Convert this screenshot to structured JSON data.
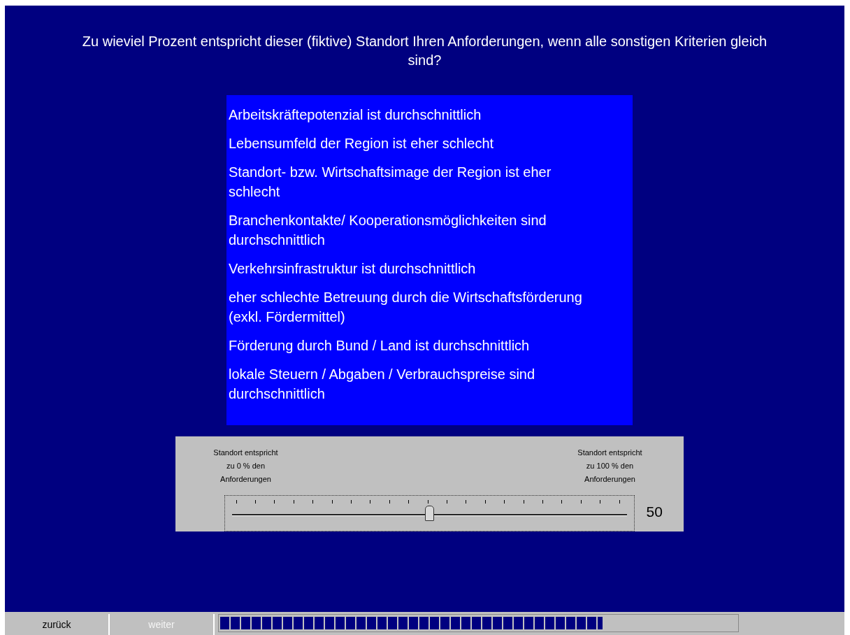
{
  "question": "Zu wieviel Prozent entspricht dieser (fiktive) Standort Ihren Anforderungen, wenn alle sonstigen Kriterien gleich sind?",
  "criteria": [
    "Arbeitskräftepotenzial ist durchschnittlich",
    "Lebensumfeld der Region ist eher schlecht",
    "Standort- bzw. Wirtschaftsimage der Region ist eher schlecht",
    "Branchenkontakte/ Kooperationsmöglichkeiten sind durchschnittlich",
    "Verkehrsinfrastruktur ist durchschnittlich",
    "eher schlechte Betreuung durch die Wirtschaftsförderung (exkl. Fördermittel)",
    "Förderung durch Bund / Land ist durchschnittlich",
    "lokale Steuern / Abgaben / Verbrauchspreise sind durchschnittlich"
  ],
  "rating": {
    "min_label": "Standort entspricht zu 0 % den Anforderungen",
    "max_label": "Standort entspricht zu 100 % den Anforderungen",
    "level": 0.5,
    "value": "50"
  },
  "nav": [
    {
      "label": "zurück",
      "disabled": false
    },
    {
      "label": "weiter",
      "disabled": true
    }
  ],
  "progress": {
    "level": 0.74
  }
}
